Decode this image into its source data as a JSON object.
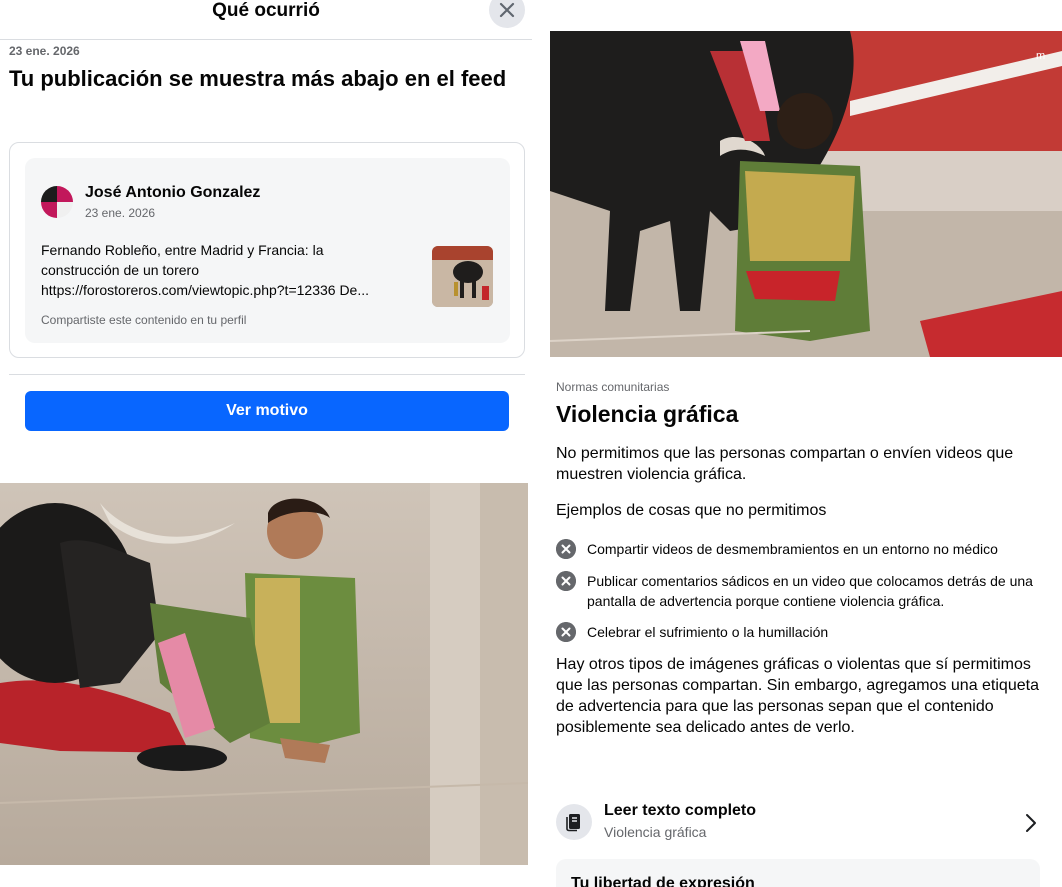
{
  "header": {
    "title": "Qué ocurrió"
  },
  "notice": {
    "date": "23 ene. 2026",
    "headline": "Tu publicación se muestra más abajo en el feed"
  },
  "post": {
    "author": "José Antonio Gonzalez",
    "date": "23 ene. 2026",
    "text_line1": "Fernando Robleño, entre Madrid y Francia: la",
    "text_line2": "construcción de un torero",
    "text_line3": "https://forostoreros.com/viewtopic.php?t=12336 De...",
    "shared_note": "Compartiste este contenido en tu perfil"
  },
  "actions": {
    "ver_motivo": "Ver motivo"
  },
  "norms": {
    "category": "Normas comunitarias",
    "title": "Violencia gráfica",
    "intro": "No permitimos que las personas compartan o envíen videos que muestren violencia gráfica.",
    "examples_heading": "Ejemplos de cosas que no permitimos",
    "examples": [
      "Compartir videos de desmembramientos en un entorno no médico",
      "Publicar comentarios sádicos en un video que colocamos detrás de una pantalla de advertencia porque contiene violencia gráfica.",
      "Celebrar el sufrimiento o la humillación"
    ],
    "allowed": "Hay otros tipos de imágenes gráficas o violentas que sí permitimos que las personas compartan. Sin embargo, agregamos una etiqueta de advertencia para que las personas sepan que el contenido posiblemente sea delicado antes de verlo."
  },
  "read_full": {
    "title": "Leer texto completo",
    "subtitle": "Violencia gráfica"
  },
  "freedom": {
    "title": "Tu libertad de expresión"
  },
  "icons": [
    "close-icon",
    "book-icon",
    "chevron-right-icon",
    "x-circle-icon"
  ],
  "colors": {
    "primary": "#0866ff",
    "secondary_text": "#65676b",
    "divider": "#dadde1"
  }
}
